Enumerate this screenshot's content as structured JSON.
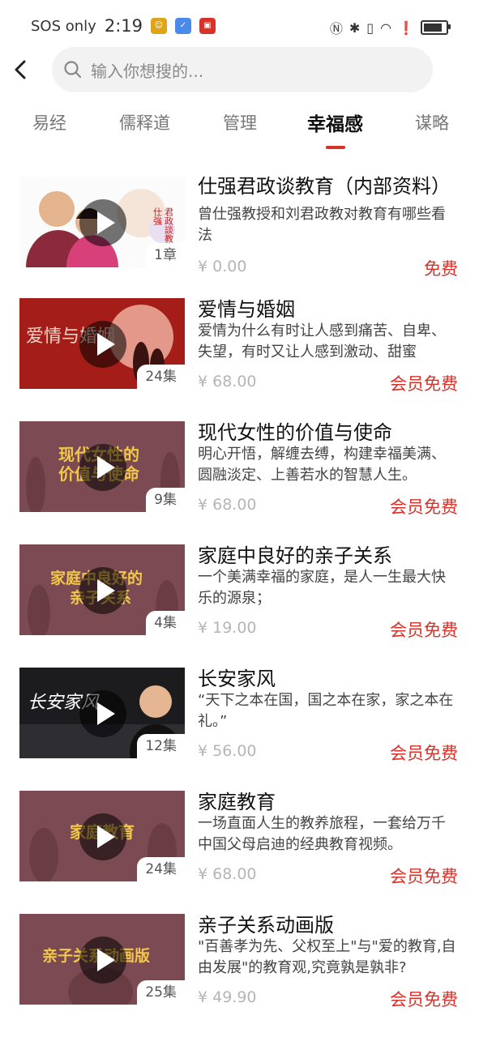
{
  "status_bar": {
    "carrier": "SOS only",
    "time": "2:19",
    "mini_apps": [
      "app-badge-1",
      "app-badge-2",
      "app-badge-3"
    ],
    "icons": [
      "nfc-icon",
      "bluetooth-icon",
      "vibrate-icon",
      "wifi-icon",
      "alert-icon",
      "battery-icon"
    ]
  },
  "search": {
    "placeholder": "输入你想搜的..."
  },
  "tabs": [
    {
      "label": "易经"
    },
    {
      "label": "儒释道"
    },
    {
      "label": "管理"
    },
    {
      "label": "幸福感",
      "active": true
    },
    {
      "label": "谋略"
    }
  ],
  "items": [
    {
      "title": "仕强君政谈教育（内部资料）",
      "desc": "曾仕强教授和刘君政教对教育有哪些看法",
      "count": "1章",
      "price": "¥ 0.00",
      "tag": "免费"
    },
    {
      "title": "爱情与婚姻",
      "desc": "爱情为什么有时让人感到痛苦、自卑、失望，有时又让人感到激动、甜蜜",
      "count": "24集",
      "price": "¥ 68.00",
      "tag": "会员免费"
    },
    {
      "title": "现代女性的价值与使命",
      "desc": "明心开悟，解缠去缚，构建幸福美满、圆融淡定、上善若水的智慧人生。",
      "count": "9集",
      "price": "¥ 68.00",
      "tag": "会员免费"
    },
    {
      "title": "家庭中良好的亲子关系",
      "desc": "一个美满幸福的家庭，是人一生最大快乐的源泉；",
      "count": "4集",
      "price": "¥ 19.00",
      "tag": "会员免费"
    },
    {
      "title": "长安家风",
      "desc": "“天下之本在国，国之本在家，家之本在礼。”",
      "count": "12集",
      "price": "¥ 56.00",
      "tag": "会员免费"
    },
    {
      "title": "家庭教育",
      "desc": "一场直面人生的教养旅程，一套给万千中国父母启迪的经典教育视频。",
      "count": "24集",
      "price": "¥ 68.00",
      "tag": "会员免费"
    },
    {
      "title": "亲子关系动画版",
      "desc": "\"百善孝为先、父权至上\"与\"爱的教育,自由发展\"的教育观,究竟孰是孰非?",
      "count": "25集",
      "price": "¥ 49.90",
      "tag": "会员免费"
    }
  ],
  "thumb_text": {
    "t0": [
      "仕強",
      "君政談教"
    ],
    "t1": "爱情与婚姻",
    "t2": [
      "现代女性的",
      "价值与使命"
    ],
    "t3": [
      "家庭中良好的",
      "亲子关系"
    ],
    "t4": "长安家风",
    "t5": "家庭教育",
    "t6": "亲子关系动画版"
  },
  "colors": {
    "accent": "#d6322a",
    "muted": "#b5b5b5"
  }
}
